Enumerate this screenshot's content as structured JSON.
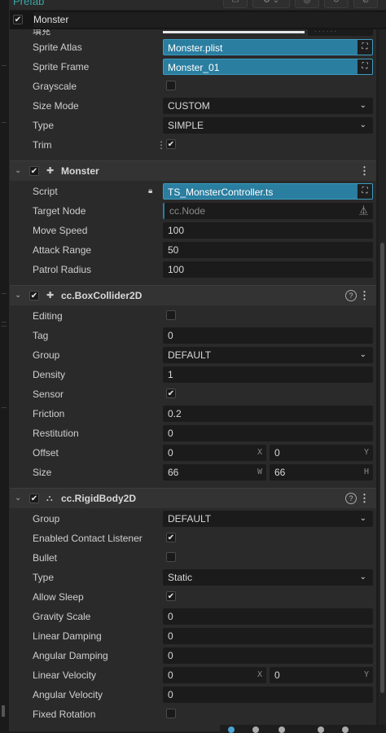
{
  "header": {
    "prefab_label": "Prefab",
    "node_active": true,
    "node_name": "Monster"
  },
  "sprite": {
    "partial_label": "填充",
    "rows": [
      {
        "label": "Sprite Atlas",
        "value": "Monster.plist",
        "kind": "asset"
      },
      {
        "label": "Sprite Frame",
        "value": "Monster_01",
        "kind": "asset"
      },
      {
        "label": "Grayscale",
        "checked": false,
        "kind": "check"
      },
      {
        "label": "Size Mode",
        "value": "CUSTOM",
        "kind": "select"
      },
      {
        "label": "Type",
        "value": "SIMPLE",
        "kind": "select"
      },
      {
        "label": "Trim",
        "checked": true,
        "kind": "check"
      }
    ]
  },
  "monster_component": {
    "title": "Monster",
    "enabled": true,
    "rows": [
      {
        "label": "Script",
        "value": "TS_MonsterController.ts"
      },
      {
        "label": "Target Node",
        "placeholder": "cc.Node"
      },
      {
        "label": "Move Speed",
        "value": "100"
      },
      {
        "label": "Attack Range",
        "value": "50"
      },
      {
        "label": "Patrol Radius",
        "value": "100"
      }
    ]
  },
  "box_collider": {
    "title": "cc.BoxCollider2D",
    "enabled": true,
    "editing_label": "Editing",
    "editing": false,
    "tag_label": "Tag",
    "tag": "0",
    "group_label": "Group",
    "group": "DEFAULT",
    "density_label": "Density",
    "density": "1",
    "sensor_label": "Sensor",
    "sensor": true,
    "friction_label": "Friction",
    "friction": "0.2",
    "restitution_label": "Restitution",
    "restitution": "0",
    "offset_label": "Offset",
    "offset_x": "0",
    "offset_y": "0",
    "size_label": "Size",
    "size_w": "66",
    "size_h": "66",
    "axis_x": "X",
    "axis_y": "Y",
    "axis_w": "W",
    "axis_h": "H"
  },
  "rigid_body": {
    "title": "cc.RigidBody2D",
    "enabled": true,
    "group_label": "Group",
    "group": "DEFAULT",
    "contact_label": "Enabled Contact Listener",
    "contact": true,
    "bullet_label": "Bullet",
    "bullet": false,
    "type_label": "Type",
    "type": "Static",
    "allow_sleep_label": "Allow Sleep",
    "allow_sleep": true,
    "gravity_label": "Gravity Scale",
    "gravity": "0",
    "linear_damping_label": "Linear Damping",
    "linear_damping": "0",
    "angular_damping_label": "Angular Damping",
    "angular_damping": "0",
    "linear_velocity_label": "Linear Velocity",
    "linear_velocity_x": "0",
    "linear_velocity_y": "0",
    "angular_velocity_label": "Angular Velocity",
    "angular_velocity": "0",
    "fixed_rotation_label": "Fixed Rotation",
    "fixed_rotation": false
  },
  "icons": {
    "check": "✔",
    "chevron": "⌄",
    "expand": "⌄",
    "lock": "🔒",
    "folder": "⛶",
    "menu": "⋮",
    "help": "?",
    "node": "⏅",
    "puzzle": "✚"
  },
  "colors": {
    "accent": "#2a7ea0",
    "panel": "#2a2a2a",
    "field": "#1b1b1b"
  }
}
